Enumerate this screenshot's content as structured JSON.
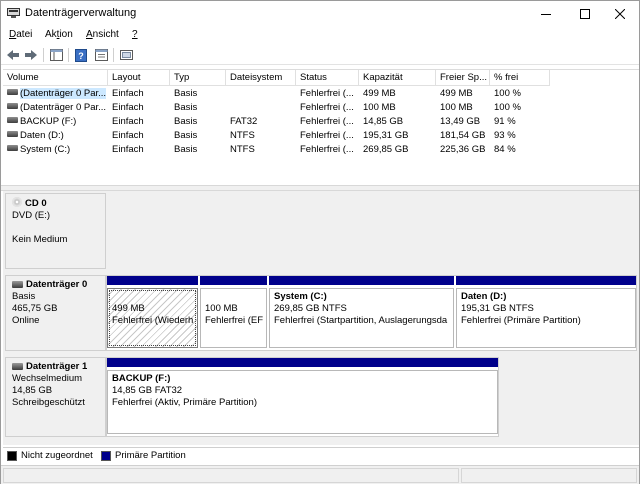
{
  "window": {
    "title": "Datenträgerverwaltung"
  },
  "menu": [
    {
      "pre": "",
      "ul": "D",
      "post": "atei"
    },
    {
      "pre": "Ak",
      "ul": "t",
      "post": "ion"
    },
    {
      "pre": "",
      "ul": "A",
      "post": "nsicht"
    },
    {
      "pre": "",
      "ul": "?",
      "post": ""
    }
  ],
  "toolbar": {
    "icons": [
      "back-arrow-icon",
      "forward-arrow-icon",
      "console-tree-icon",
      "help-icon",
      "properties-icon",
      "settings-icon"
    ]
  },
  "volumes": {
    "columns": [
      "Volume",
      "Layout",
      "Typ",
      "Dateisystem",
      "Status",
      "Kapazität",
      "Freier Sp...",
      "% frei"
    ],
    "rows": [
      [
        "(Datenträger 0 Par...",
        "Einfach",
        "Basis",
        "",
        "Fehlerfrei (...",
        "499 MB",
        "499 MB",
        "100 %"
      ],
      [
        "(Datenträger 0 Par...",
        "Einfach",
        "Basis",
        "",
        "Fehlerfrei (...",
        "100 MB",
        "100 MB",
        "100 %"
      ],
      [
        "BACKUP (F:)",
        "Einfach",
        "Basis",
        "FAT32",
        "Fehlerfrei (...",
        "14,85 GB",
        "13,49 GB",
        "91 %"
      ],
      [
        "Daten (D:)",
        "Einfach",
        "Basis",
        "NTFS",
        "Fehlerfrei (...",
        "195,31 GB",
        "181,54 GB",
        "93 %"
      ],
      [
        "System (C:)",
        "Einfach",
        "Basis",
        "NTFS",
        "Fehlerfrei (...",
        "269,85 GB",
        "225,36 GB",
        "84 %"
      ]
    ]
  },
  "disks": [
    {
      "name": "CD 0",
      "lines": [
        "DVD (E:)",
        "",
        "Kein Medium"
      ],
      "partitions": []
    },
    {
      "name": "Datenträger 0",
      "lines": [
        "Basis",
        "465,75 GB",
        "Online"
      ],
      "partitions": [
        {
          "name": "",
          "size": "499 MB",
          "status": "Fehlerfrei (Wiederh"
        },
        {
          "name": "",
          "size": "100 MB",
          "status": "Fehlerfrei (EF"
        },
        {
          "name": "System  (C:)",
          "size": "269,85 GB NTFS",
          "status": "Fehlerfrei (Startpartition, Auslagerungsda"
        },
        {
          "name": "Daten  (D:)",
          "size": "195,31 GB NTFS",
          "status": "Fehlerfrei (Primäre Partition)"
        }
      ]
    },
    {
      "name": "Datenträger 1",
      "lines": [
        "Wechselmedium",
        "14,85 GB",
        "Schreibgeschützt"
      ],
      "partitions": [
        {
          "name": "BACKUP  (F:)",
          "size": "14,85 GB FAT32",
          "status": "Fehlerfrei (Aktiv, Primäre Partition)"
        }
      ]
    }
  ],
  "legend": [
    {
      "label": "Nicht zugeordnet",
      "color": "#000000"
    },
    {
      "label": "Primäre Partition",
      "color": "#00008b"
    }
  ],
  "colors": {
    "primary_partition": "#00008b",
    "selection": "#cce8ff"
  }
}
